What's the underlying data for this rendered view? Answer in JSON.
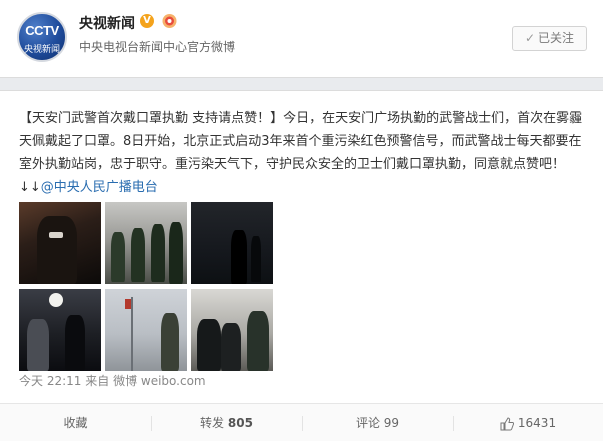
{
  "account": {
    "name": "央视新闻",
    "description": "中央电视台新闻中心官方微博",
    "avatar_logo": "CCTV",
    "avatar_sub": "央视新闻",
    "follow_label": "已关注"
  },
  "post": {
    "text": "【天安门武警首次戴口罩执勤 支持请点赞！】今日，在天安门广场执勤的武警战士们，首次在雾霾天佩戴起了口罩。8日开始，北京正式启动3年来首个重污染红色预警信号，而武警战士每天都要在室外执勤站岗，忠于职守。重污染天气下，守护民众安全的卫士们戴口罩执勤，同意就点赞吧！↓↓",
    "mention": "@中央人民广播电台",
    "time": "今天 22:11",
    "source_prefix": "来自",
    "source": "微博 weibo.com"
  },
  "actions": {
    "favorite_label": "收藏",
    "repost_label": "转发",
    "repost_count": "805",
    "comment_label": "评论",
    "comment_count": "99",
    "like_count": "16431"
  },
  "colors": {
    "accent_link": "#2a6db0",
    "verified": "#f4a31c"
  }
}
